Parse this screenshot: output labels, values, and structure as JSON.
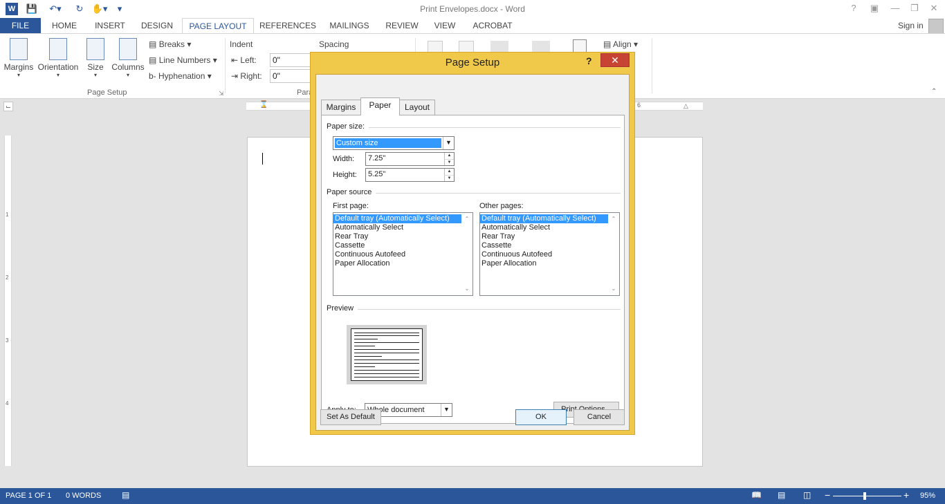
{
  "window": {
    "title": "Print Envelopes.docx - Word",
    "sign_in": "Sign in"
  },
  "ribbon_tabs": [
    "FILE",
    "HOME",
    "INSERT",
    "DESIGN",
    "PAGE LAYOUT",
    "REFERENCES",
    "MAILINGS",
    "REVIEW",
    "VIEW",
    "ACROBAT"
  ],
  "active_tab": "PAGE LAYOUT",
  "ribbon": {
    "margins": "Margins",
    "orientation": "Orientation",
    "size": "Size",
    "columns": "Columns",
    "breaks": "Breaks",
    "line_numbers": "Line Numbers",
    "hyphenation": "Hyphenation",
    "page_setup_group": "Page Setup",
    "indent": "Indent",
    "left_label": "Left:",
    "right_label": "Right:",
    "left_value": "0\"",
    "right_value": "0\"",
    "spacing": "Spacing",
    "paragraph_group": "Para",
    "align": "Align"
  },
  "dialog": {
    "title": "Page Setup",
    "help": "?",
    "close": "✕",
    "tabs": [
      "Margins",
      "Paper",
      "Layout"
    ],
    "active_tab": "Paper",
    "paper_size_label": "Paper size:",
    "paper_size_value": "Custom size",
    "width_label": "Width:",
    "width_value": "7.25\"",
    "height_label": "Height:",
    "height_value": "5.25\"",
    "paper_source_label": "Paper source",
    "first_page_label": "First page:",
    "other_pages_label": "Other pages:",
    "trays": [
      "Default tray (Automatically Select)",
      "Automatically Select",
      "Rear Tray",
      "Cassette",
      "Continuous Autofeed",
      "Paper Allocation"
    ],
    "selected_tray": "Default tray (Automatically Select)",
    "preview_label": "Preview",
    "apply_to_label": "Apply to:",
    "apply_to_value": "Whole document",
    "print_options": "Print Options...",
    "set_as_default": "Set As Default",
    "ok": "OK",
    "cancel": "Cancel"
  },
  "status": {
    "page": "PAGE 1 OF 1",
    "words": "0 WORDS",
    "zoom": "95%"
  },
  "colors": {
    "word_blue": "#2b579a",
    "dialog_frame": "#f0c84a",
    "selection": "#3399ff",
    "close_red": "#c74333"
  }
}
